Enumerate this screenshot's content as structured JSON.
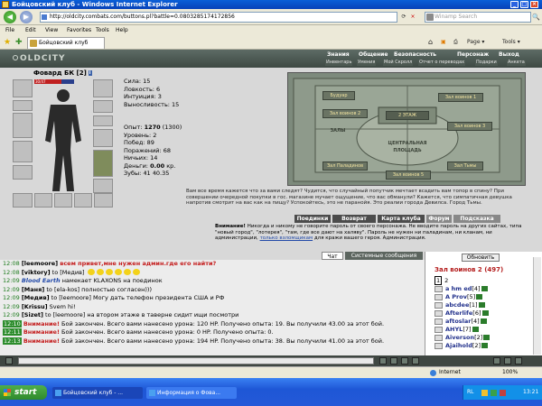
{
  "window": {
    "title": "Бойцовский клуб - Windows Internet Explorer",
    "min": "_",
    "max": "□",
    "close": "×"
  },
  "nav": {
    "back": "◀",
    "forward": "▶",
    "url": "http://oldcity.combats.com/buttons.pl?battle=0.0803285174172856",
    "refresh": "⟳",
    "stop": "×",
    "search_placeholder": "Winamp Search",
    "search_go": "🔍"
  },
  "menu": [
    "File",
    "Edit",
    "View",
    "Favorites",
    "Tools",
    "Help"
  ],
  "tabs": {
    "active": "Бойцовский клуб",
    "home": "⌂",
    "feeds": "▣",
    "print": "⎙",
    "page": "Page ▾",
    "tools": "Tools ▾"
  },
  "game": {
    "logo": "OLDCITY",
    "top_menu": [
      "Знания",
      "Общение",
      "Безопасность",
      "Персонаж",
      "Выход"
    ],
    "sub_menu": [
      "Инвентарь",
      "Умения",
      "Мой Скролл",
      "Отчет о переводах",
      "Подарки",
      "Анкета"
    ],
    "character": {
      "name": "Фовард БК",
      "level": "[2]",
      "info": "i",
      "hp": "30/47",
      "stats": [
        "Сила: 15",
        "Ловкость: 6",
        "Интуиция: 3",
        "Выносливость: 15"
      ],
      "exp_label": "Опыт:",
      "exp": "1270",
      "exp_next": "(1300)",
      "stats2": [
        "Уровень: 2",
        "Побед: 89",
        "Поражений: 68",
        "Ничьих: 14"
      ],
      "money_label": "Деньги:",
      "money": "0.00",
      "money_unit": "кр.",
      "teeth": "Зубы: ₰1 ₰0.35"
    },
    "map": {
      "labels": [
        "Будуар",
        "Зал воинов 1",
        "Зал воинов 2",
        "Зал воинов 3",
        "2 ЭТАЖ",
        "ЗАЛЫ",
        "ЦЕНТРАЛЬНАЯ ПЛОЩАДЬ",
        "Зал Паладинов",
        "Зал Тьмы",
        "Зал воинов 5"
      ]
    },
    "hint": "Вам все время кажется что за вами следят? Чудится, что случайный попутчик мечтает всадить вам топор в спину? При совершении очередной покупки в гос. магазине мучает ощущение, что вас обманули? Кажется, что симпатичная девушка напротив смотрит на вас как на пищу? Успокойтесь, это не паранойя. Это реалии города Девилса. Город Тьмы.",
    "buttons": [
      "Поединки",
      "Возврат",
      "Карта клуба",
      "Форум",
      "Подсказка"
    ],
    "warning_label": "Внимание!",
    "warning": "Никогда и никому не говорите пароль от своего персонажа. Не вводите пароль на других сайтах, типа \"новый город\", \"лотерея\", \"там, где все дают на халяву\". Пароль не нужен ни паладинам, ни кланам, ни администрации,",
    "warning_end": "для кражи вашего героя. Администрация.",
    "warning_link": "только взломщикам"
  },
  "chat": {
    "tabs": [
      "Чат",
      "Системные сообщения"
    ],
    "lines": [
      {
        "ts": "12:08",
        "nick": "[leemoore]",
        "text": "всем привет,мне нужен админ.где его найти?",
        "style": "red"
      },
      {
        "ts": "12:08",
        "nick": "[viktory]",
        "text": "to [Медив]",
        "style": "smiles"
      },
      {
        "ts": "12:09",
        "nick": "Blood Earth",
        "text": "намекает KLAXONS на поединок",
        "style": "blue"
      },
      {
        "ts": "12:09",
        "nick": "[Маня]",
        "text": "to [ela-kos] полностью согласен)))",
        "style": "plain"
      },
      {
        "ts": "12:09",
        "nick": "[Медив]",
        "text": "to [leemoore] Могу дать телефон президента США и РФ",
        "style": "plain"
      },
      {
        "ts": "12:09",
        "nick": "[Krissu]",
        "text": "Svem hi!",
        "style": "plain"
      },
      {
        "ts": "12:09",
        "nick": "[Sizet]",
        "text": "to [leemoore] на втором этаже в таверне сидит ищи посмотри",
        "style": "plain"
      },
      {
        "ts": "12:10",
        "nick": "Внимание!",
        "text": "Бой закончен. Всего вами нанесено урона: 120 HP. Получено опыта: 19. Вы получили ₰3.00 за этот бой.",
        "style": "sys"
      },
      {
        "ts": "12:11",
        "nick": "Внимание!",
        "text": "Бой закончен. Всего вами нанесено урона: 0 HP. Получено опыта: 0.",
        "style": "sys"
      },
      {
        "ts": "12:13",
        "nick": "Внимание!",
        "text": "Бой закончен. Всего вами нанесено урона: 194 HP. Получено опыта: 38. Вы получили ₰1.00 за этот бой.",
        "style": "sys"
      }
    ]
  },
  "room": {
    "refresh": "Обновить",
    "title": "Зал воинов 2 (497)",
    "pages": [
      "1",
      "2"
    ],
    "players": [
      {
        "name": "a hm ed",
        "lv": "[4]"
      },
      {
        "name": "A Prov",
        "lv": "[5]"
      },
      {
        "name": "abcdee",
        "lv": "[1]"
      },
      {
        "name": "Afterlife",
        "lv": "[6]"
      },
      {
        "name": "aftoslar",
        "lv": "[4]"
      },
      {
        "name": "AHYL",
        "lv": "[7]"
      },
      {
        "name": "Aiverson",
        "lv": "[2]"
      },
      {
        "name": "Ajaihold",
        "lv": "[2]"
      }
    ]
  },
  "status": {
    "zone": "Internet",
    "zoom": "100%",
    "lang": "RL"
  },
  "taskbar": {
    "start": "start",
    "tasks": [
      "Бойцовский клуб - ...",
      "Информация о Фова..."
    ],
    "time": "13:21"
  }
}
